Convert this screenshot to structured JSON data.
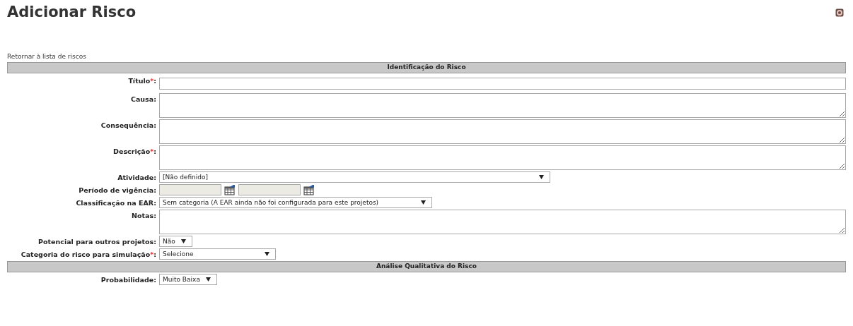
{
  "page_title": "Adicionar Risco",
  "back_link": "Retornar à lista de riscos",
  "sections": [
    {
      "title": "Identificação do Risco",
      "fields": [
        {
          "kind": "text",
          "label": "Título",
          "required_mark": "*",
          "colon": ":"
        },
        {
          "kind": "textarea",
          "label": "Causa",
          "colon": ":"
        },
        {
          "kind": "textarea",
          "label": "Consequência",
          "colon": ":"
        },
        {
          "kind": "textarea",
          "label": "Descrição",
          "required_mark": "*",
          "colon": ":"
        },
        {
          "kind": "select",
          "label": "Atividade",
          "colon": ":",
          "value": "[Não definido]"
        },
        {
          "kind": "daterange",
          "label": "Período de vigência",
          "colon": ":"
        },
        {
          "kind": "select",
          "label": "Classificação na EAR",
          "colon": ":",
          "value": "Sem categoria (A EAR ainda não foi configurada para este projetos)"
        },
        {
          "kind": "textarea",
          "label": "Notas",
          "colon": ":"
        },
        {
          "kind": "select",
          "label": "Potencial para outros projetos",
          "colon": ":",
          "value": "Não"
        },
        {
          "kind": "select",
          "label": "Categoria do risco para simulação",
          "required_mark": "*",
          "colon": ":",
          "value": "Selecione"
        }
      ]
    },
    {
      "title": "Análise Qualitativa do Risco",
      "fields": [
        {
          "kind": "select",
          "label": "Probabilidade",
          "colon": ":",
          "value": "Muito Baixa"
        }
      ]
    }
  ]
}
